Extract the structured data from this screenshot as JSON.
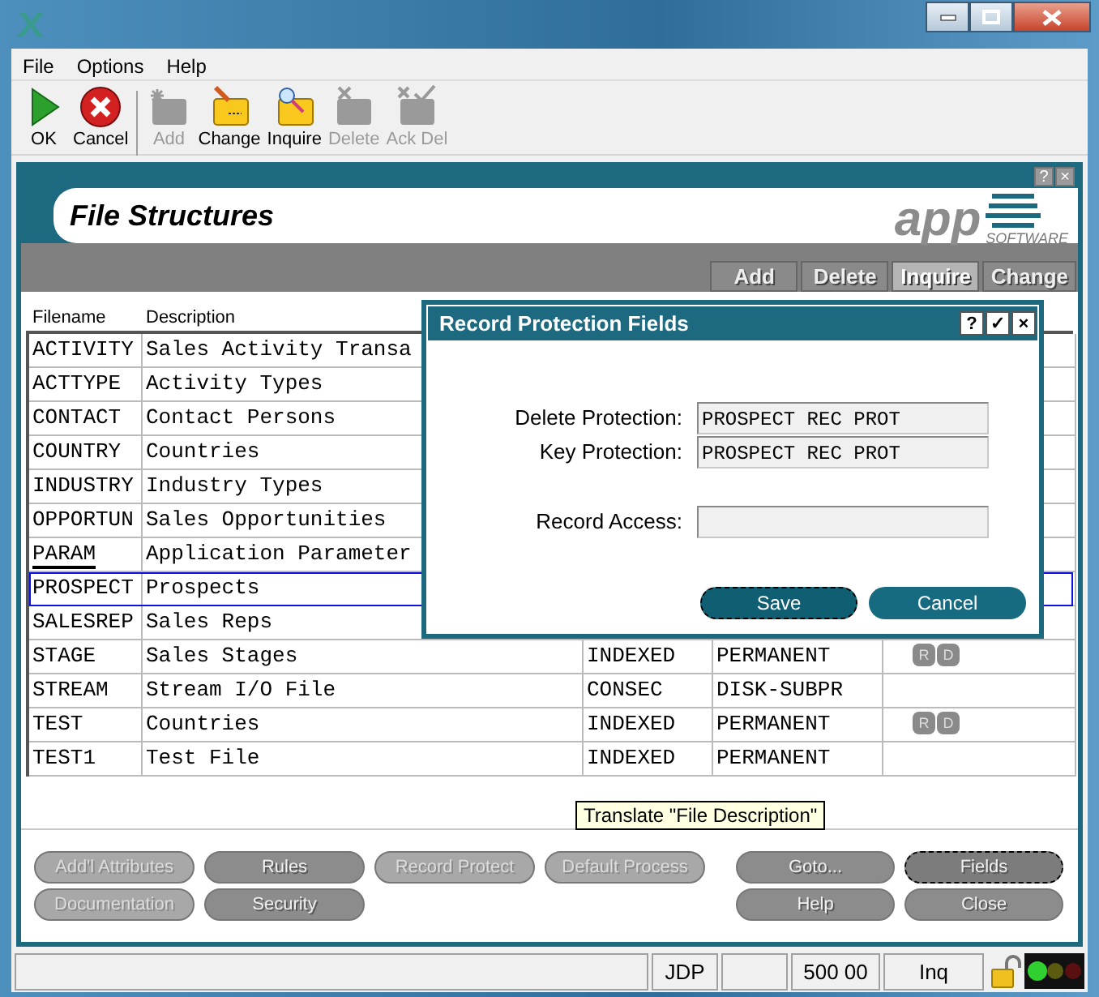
{
  "menu": [
    "File",
    "Options",
    "Help"
  ],
  "toolbar": [
    {
      "label": "OK",
      "kind": "ok",
      "disabled": false
    },
    {
      "label": "Cancel",
      "kind": "cancel",
      "disabled": false
    },
    {
      "label": "Add",
      "kind": "add",
      "disabled": true
    },
    {
      "label": "Change",
      "kind": "change",
      "disabled": false
    },
    {
      "label": "Inquire",
      "kind": "inquire",
      "disabled": false
    },
    {
      "label": "Delete",
      "kind": "delete",
      "disabled": true
    },
    {
      "label": "Ack Del",
      "kind": "ack",
      "disabled": true
    }
  ],
  "panel": {
    "title": "File Structures",
    "corner_buttons": [
      "?",
      "×"
    ],
    "logo": {
      "name": "app",
      "tagline": "SOFTWARE"
    },
    "modes": [
      {
        "label": "Add",
        "selected": false
      },
      {
        "label": "Delete",
        "selected": false
      },
      {
        "label": "Inquire",
        "selected": true
      },
      {
        "label": "Change",
        "selected": false
      }
    ]
  },
  "table": {
    "columns": [
      "Filename",
      "Description"
    ],
    "rows": [
      {
        "filename": "ACTIVITY",
        "description": "Sales Activity Transa",
        "selected": false,
        "focused": false
      },
      {
        "filename": "ACTTYPE",
        "description": "Activity Types",
        "selected": false,
        "focused": false
      },
      {
        "filename": "CONTACT",
        "description": "Contact Persons",
        "selected": false,
        "focused": false
      },
      {
        "filename": "COUNTRY",
        "description": "Countries",
        "selected": false,
        "focused": false
      },
      {
        "filename": "INDUSTRY",
        "description": "Industry Types",
        "selected": false,
        "focused": false
      },
      {
        "filename": "OPPORTUN",
        "description": "Sales Opportunities",
        "selected": false,
        "focused": false
      },
      {
        "filename": "PARAM",
        "description": "Application Parameter",
        "selected": false,
        "focused": true
      },
      {
        "filename": "PROSPECT",
        "description": "Prospects",
        "selected": true,
        "focused": false
      },
      {
        "filename": "SALESREP",
        "description": "Sales Reps",
        "selected": false,
        "focused": false
      },
      {
        "filename": "STAGE",
        "description": "Sales Stages",
        "column_3": "INDEXED",
        "column_4": "PERMANENT",
        "column_5": [
          "R",
          "D"
        ],
        "selected": false,
        "focused": false
      },
      {
        "filename": "STREAM",
        "description": "Stream I/O File",
        "column_3": "CONSEC",
        "column_4": "DISK-SUBPR",
        "selected": false,
        "focused": false
      },
      {
        "filename": "TEST",
        "description": "Countries",
        "column_3": "INDEXED",
        "column_4": "PERMANENT",
        "column_5": [
          "R",
          "D"
        ],
        "selected": false,
        "focused": false
      },
      {
        "filename": "TEST1",
        "description": "Test File",
        "column_3": "INDEXED",
        "column_4": "PERMANENT",
        "selected": false,
        "focused": false
      }
    ]
  },
  "tooltip": "Translate \"File Description\"",
  "actions_left": [
    {
      "label": "Add'l Attributes",
      "disabled": true
    },
    {
      "label": "Rules",
      "disabled": false
    },
    {
      "label": "Record Protect",
      "disabled": true
    },
    {
      "label": "Default Process",
      "disabled": true
    },
    {
      "label": "Documentation",
      "disabled": true
    },
    {
      "label": "Security",
      "disabled": false
    }
  ],
  "actions_right": [
    {
      "label": "Goto...",
      "focused": false
    },
    {
      "label": "Fields",
      "focused": true
    },
    {
      "label": "Help",
      "focused": false
    },
    {
      "label": "Close",
      "focused": false
    }
  ],
  "dialog": {
    "title": "Record Protection Fields",
    "title_buttons": [
      "?",
      "✓",
      "×"
    ],
    "fields": [
      {
        "label": "Delete Protection:",
        "value": "PROSPECT REC PROT"
      },
      {
        "label": "Key Protection:",
        "value": "PROSPECT REC PROT"
      },
      {
        "label": "Record Access:"
      }
    ],
    "buttons": [
      {
        "label": "Save",
        "focused": true
      },
      {
        "label": "Cancel",
        "focused": false
      }
    ]
  },
  "status_bar": [
    "JDP",
    "500 00",
    "Inq"
  ]
}
